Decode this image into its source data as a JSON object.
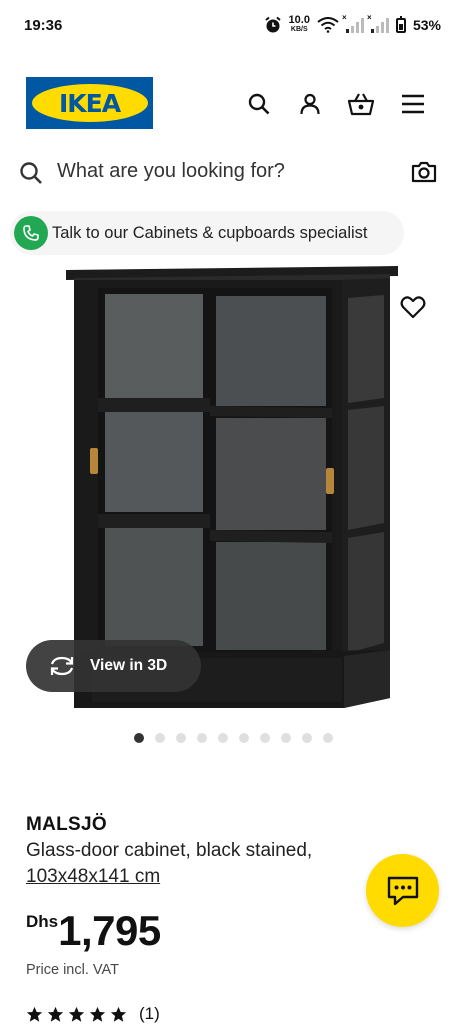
{
  "status_bar": {
    "time": "19:36",
    "net_speed_value": "10.0",
    "net_speed_unit": "KB/S",
    "battery": "53%",
    "icons": [
      "alarm-icon",
      "wifi-icon",
      "signal-icon",
      "signal-icon",
      "battery-icon"
    ]
  },
  "header": {
    "logo_text": "IKEA",
    "icons": [
      "search-icon",
      "account-icon",
      "basket-icon",
      "menu-icon"
    ],
    "brand_colors": {
      "blue": "#0058a3",
      "yellow": "#ffdb00"
    }
  },
  "search": {
    "placeholder": "What are you looking for?",
    "camera_icon": "camera-icon"
  },
  "specialist_chip": {
    "label": "Talk to our Cabinets & cupboards specialist",
    "icon": "phone-icon",
    "icon_color": "#22a853"
  },
  "gallery": {
    "image_alt": "Black glass-door cabinet with sliding doors",
    "view_3d_label": "View in 3D",
    "favourite_icon": "heart-icon",
    "total_images": 10,
    "active_index": 0
  },
  "product": {
    "name": "MALSJÖ",
    "description": "Glass-door cabinet, black stained,",
    "dimensions": "103x48x141 cm",
    "currency": "Dhs",
    "price": "1,795",
    "price_note": "Price incl. VAT",
    "rating_stars": 5,
    "review_count": "(1)"
  },
  "chat": {
    "icon": "chat-icon"
  }
}
